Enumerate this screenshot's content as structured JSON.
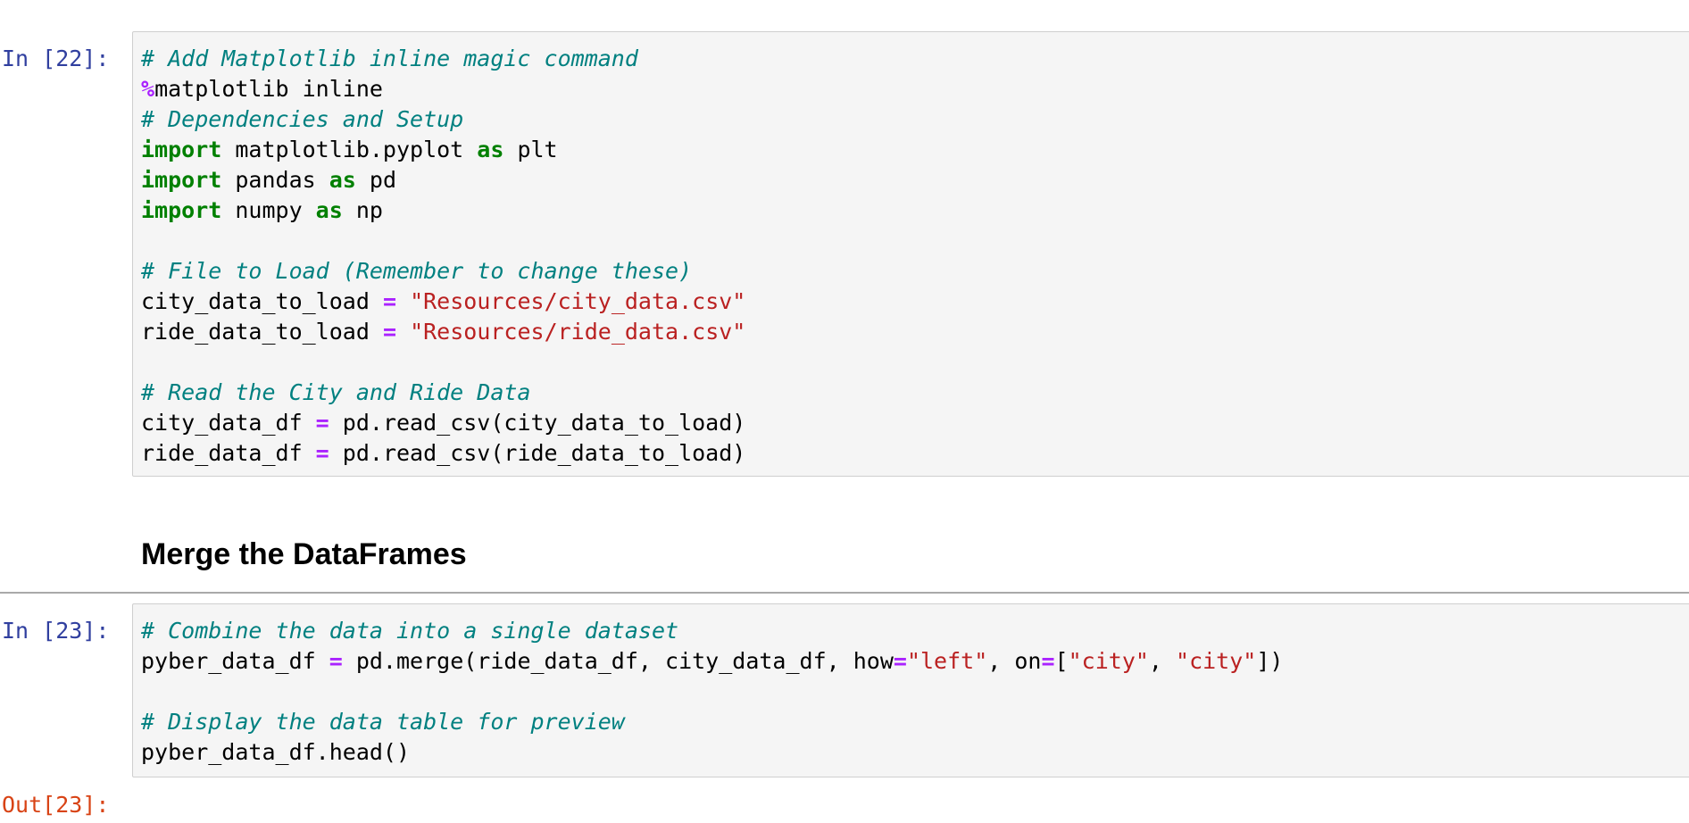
{
  "cells": {
    "code1": {
      "prompt": "In [22]:",
      "lines": [
        [
          {
            "t": "# Add Matplotlib inline magic command",
            "c": "comment"
          }
        ],
        [
          {
            "t": "%",
            "c": "op"
          },
          {
            "t": "matplotlib inline",
            "c": "plain"
          }
        ],
        [
          {
            "t": "# Dependencies and Setup",
            "c": "comment"
          }
        ],
        [
          {
            "t": "import",
            "c": "kw"
          },
          {
            "t": " matplotlib.pyplot ",
            "c": "plain"
          },
          {
            "t": "as",
            "c": "kw"
          },
          {
            "t": " plt",
            "c": "plain"
          }
        ],
        [
          {
            "t": "import",
            "c": "kw"
          },
          {
            "t": " pandas ",
            "c": "plain"
          },
          {
            "t": "as",
            "c": "kw"
          },
          {
            "t": " pd",
            "c": "plain"
          }
        ],
        [
          {
            "t": "import",
            "c": "kw"
          },
          {
            "t": " numpy ",
            "c": "plain"
          },
          {
            "t": "as",
            "c": "kw"
          },
          {
            "t": " np",
            "c": "plain"
          }
        ],
        [],
        [
          {
            "t": "# File to Load (Remember to change these)",
            "c": "comment"
          }
        ],
        [
          {
            "t": "city_data_to_load ",
            "c": "plain"
          },
          {
            "t": "=",
            "c": "op"
          },
          {
            "t": " ",
            "c": "plain"
          },
          {
            "t": "\"Resources/city_data.csv\"",
            "c": "str"
          }
        ],
        [
          {
            "t": "ride_data_to_load ",
            "c": "plain"
          },
          {
            "t": "=",
            "c": "op"
          },
          {
            "t": " ",
            "c": "plain"
          },
          {
            "t": "\"Resources/ride_data.csv\"",
            "c": "str"
          }
        ],
        [],
        [
          {
            "t": "# Read the City and Ride Data",
            "c": "comment"
          }
        ],
        [
          {
            "t": "city_data_df ",
            "c": "plain"
          },
          {
            "t": "=",
            "c": "op"
          },
          {
            "t": " pd.read_csv(city_data_to_load)",
            "c": "plain"
          }
        ],
        [
          {
            "t": "ride_data_df ",
            "c": "plain"
          },
          {
            "t": "=",
            "c": "op"
          },
          {
            "t": " pd.read_csv(ride_data_to_load)",
            "c": "plain"
          }
        ]
      ]
    },
    "markdown": {
      "heading": "Merge the DataFrames"
    },
    "code2": {
      "prompt": "In [23]:",
      "lines": [
        [
          {
            "t": "# Combine the data into a single dataset",
            "c": "comment"
          }
        ],
        [
          {
            "t": "pyber_data_df ",
            "c": "plain"
          },
          {
            "t": "=",
            "c": "op"
          },
          {
            "t": " pd.merge(ride_data_df, city_data_df, how",
            "c": "plain"
          },
          {
            "t": "=",
            "c": "op"
          },
          {
            "t": "\"left\"",
            "c": "str"
          },
          {
            "t": ", on",
            "c": "plain"
          },
          {
            "t": "=",
            "c": "op"
          },
          {
            "t": "[",
            "c": "plain"
          },
          {
            "t": "\"city\"",
            "c": "str"
          },
          {
            "t": ", ",
            "c": "plain"
          },
          {
            "t": "\"city\"",
            "c": "str"
          },
          {
            "t": "])",
            "c": "plain"
          }
        ],
        [],
        [
          {
            "t": "# Display the data table for preview",
            "c": "comment"
          }
        ],
        [
          {
            "t": "pyber_data_df.head()",
            "c": "plain"
          }
        ]
      ]
    },
    "output": {
      "prompt": "Out[23]:"
    }
  },
  "colors": {
    "comment": "#008080",
    "keyword": "#008000",
    "operator": "#AA22FF",
    "string": "#BA2121",
    "in_prompt": "#303F9F",
    "out_prompt": "#D84315",
    "cell_background": "#f5f5f5",
    "cell_border": "#cfcfcf"
  }
}
